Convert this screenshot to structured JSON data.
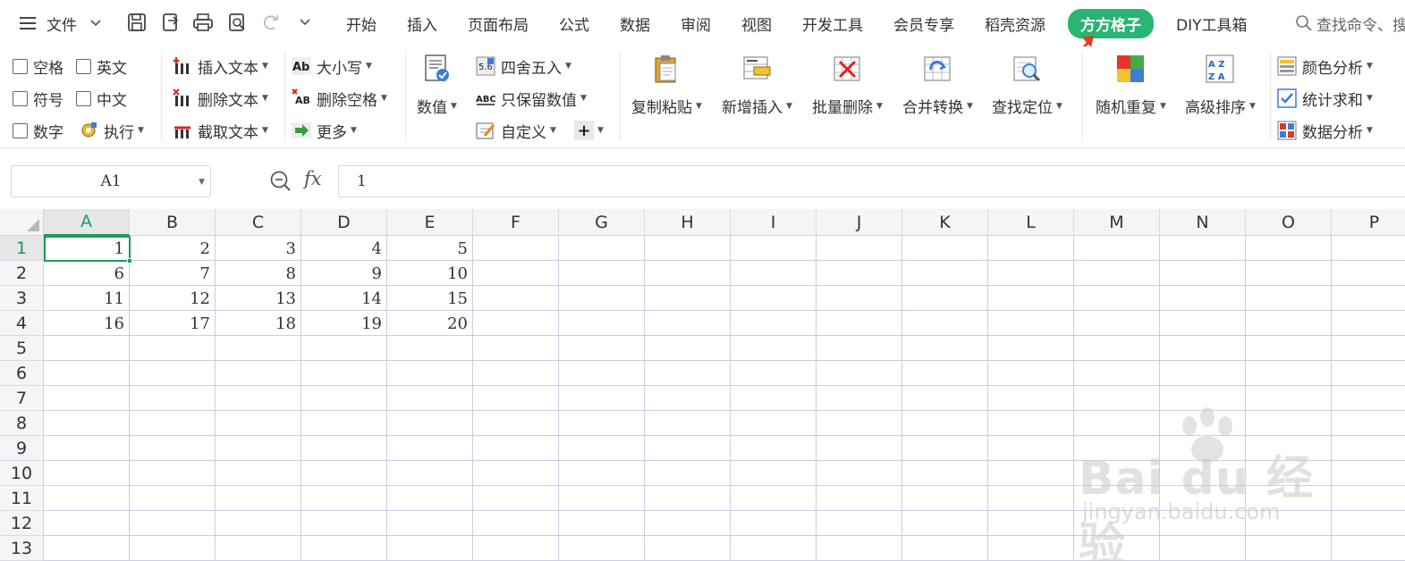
{
  "menubar": {
    "file_label": "文件",
    "tabs": [
      {
        "label": "开始",
        "active": false
      },
      {
        "label": "插入",
        "active": false
      },
      {
        "label": "页面布局",
        "active": false
      },
      {
        "label": "公式",
        "active": false
      },
      {
        "label": "数据",
        "active": false
      },
      {
        "label": "审阅",
        "active": false
      },
      {
        "label": "视图",
        "active": false
      },
      {
        "label": "开发工具",
        "active": false
      },
      {
        "label": "会员专享",
        "active": false
      },
      {
        "label": "稻壳资源",
        "active": false
      },
      {
        "label": "方方格子",
        "active": true
      },
      {
        "label": "DIY工具箱",
        "active": false
      }
    ],
    "search_label": "查找命令、搜"
  },
  "ribbon": {
    "checks": {
      "space": "空格",
      "english": "英文",
      "symbol": "符号",
      "chinese": "中文",
      "number": "数字",
      "execute": "执行"
    },
    "text_group": {
      "insert_text": "插入文本",
      "delete_text": "删除文本",
      "cut_text": "截取文本"
    },
    "case_group": {
      "case": "大小写",
      "delete_space": "删除空格",
      "more": "更多"
    },
    "numeric_label": "数值",
    "round_group": {
      "round": "四舍五入",
      "keep_numbers": "只保留数值",
      "custom": "自定义",
      "plus": "+"
    },
    "big_buttons": {
      "copy_paste": "复制粘贴",
      "add_insert": "新增插入",
      "batch_delete": "批量删除",
      "merge_convert": "合并转换",
      "find_locate": "查找定位",
      "random_repeat": "随机重复",
      "advanced_sort": "高级排序"
    },
    "analysis_group": {
      "color_analysis": "颜色分析",
      "stat_sum": "统计求和",
      "data_analysis": "数据分析"
    }
  },
  "formula_bar": {
    "name_box": "A1",
    "fx": "fx",
    "formula_value": "1"
  },
  "grid": {
    "columns": [
      "A",
      "B",
      "C",
      "D",
      "E",
      "F",
      "G",
      "H",
      "I",
      "J",
      "K",
      "L",
      "M",
      "N",
      "O",
      "P"
    ],
    "rows": [
      "1",
      "2",
      "3",
      "4",
      "5",
      "6",
      "7",
      "8",
      "9",
      "10",
      "11",
      "12",
      "13"
    ],
    "selected_column": "A",
    "selected_row": "1",
    "values": [
      [
        "1",
        "2",
        "3",
        "4",
        "5"
      ],
      [
        "6",
        "7",
        "8",
        "9",
        "10"
      ],
      [
        "11",
        "12",
        "13",
        "14",
        "15"
      ],
      [
        "16",
        "17",
        "18",
        "19",
        "20"
      ]
    ]
  },
  "watermark": {
    "brand": "Bai du 经验",
    "url": "jingyan.baidu.com"
  },
  "colors": {
    "accent": "#2ab573",
    "selection": "#1f9a5c",
    "annotation_arrow": "#e8391e"
  }
}
